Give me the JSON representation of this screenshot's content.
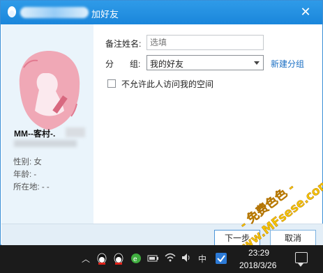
{
  "window": {
    "title": "加好友"
  },
  "profile": {
    "nickname": "MM--客村-.",
    "gender_label": "性别: 女",
    "age_label": "年龄: -",
    "location_label": "所在地: -    -"
  },
  "form": {
    "remark_label": "备注姓名:",
    "remark_placeholder": "选填",
    "group_label_1": "分",
    "group_label_2": "组:",
    "group_value": "我的好友",
    "new_group_link": "新建分组",
    "privacy_checkbox_label": "不允许此人访问我的空间"
  },
  "buttons": {
    "next": "下一步",
    "cancel": "取消"
  },
  "watermark": {
    "line1": "- 免费色色 -",
    "line2": "www.MFsese.com"
  },
  "taskbar": {
    "ime": "中",
    "time": "23:29",
    "date": "2018/3/26"
  },
  "colors": {
    "titlebar": "#1a86db",
    "link": "#1a6fc4",
    "sidebar": "#eaf4fb",
    "watermark": "#f5c400"
  }
}
